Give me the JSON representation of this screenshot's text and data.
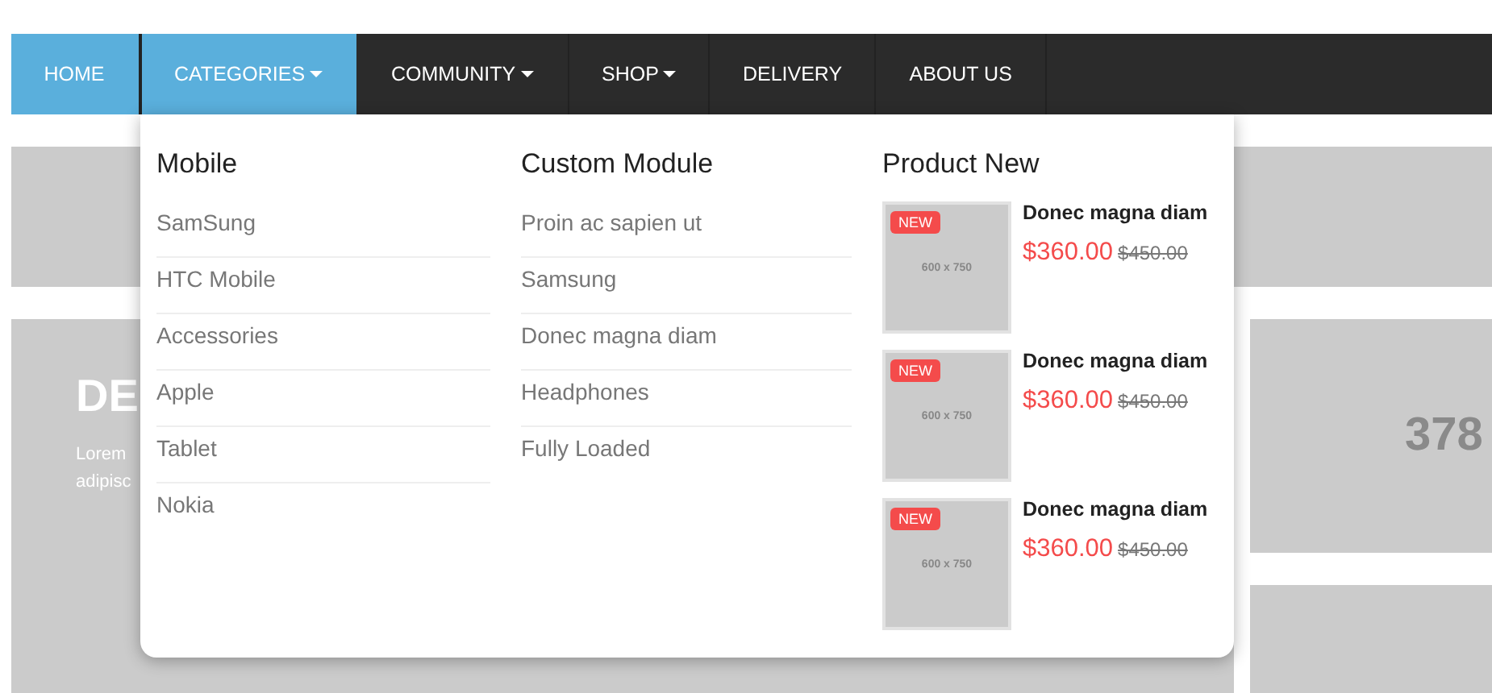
{
  "nav": [
    {
      "label": "HOME",
      "selected": true,
      "has_menu": false
    },
    {
      "label": "CATEGORIES",
      "selected": true,
      "has_menu": true
    },
    {
      "label": "COMMUNITY",
      "selected": false,
      "has_menu": true
    },
    {
      "label": "SHOP",
      "selected": false,
      "has_menu": true
    },
    {
      "label": "DELIVERY",
      "selected": false,
      "has_menu": false
    },
    {
      "label": "ABOUT US",
      "selected": false,
      "has_menu": false
    }
  ],
  "background": {
    "banner_heading": "DE",
    "banner_lines": [
      "Lorem",
      "adipisc"
    ],
    "side_number": "378"
  },
  "mega_menu": {
    "columns": [
      {
        "title": "Mobile",
        "items": [
          "SamSung",
          "HTC Mobile",
          "Accessories",
          "Apple",
          "Tablet",
          "Nokia"
        ]
      },
      {
        "title": "Custom Module",
        "items": [
          "Proin ac sapien ut",
          "Samsung",
          "Donec magna diam",
          "Headphones",
          "Fully Loaded"
        ]
      }
    ],
    "products": {
      "title": "Product New",
      "items": [
        {
          "badge": "NEW",
          "image_text": "600 x 750",
          "name": "Donec magna diam",
          "price": "$360.00",
          "old_price": "$450.00"
        },
        {
          "badge": "NEW",
          "image_text": "600 x 750",
          "name": "Donec magna diam",
          "price": "$360.00",
          "old_price": "$450.00"
        },
        {
          "badge": "NEW",
          "image_text": "600 x 750",
          "name": "Donec magna diam",
          "price": "$360.00",
          "old_price": "$450.00"
        }
      ]
    }
  }
}
